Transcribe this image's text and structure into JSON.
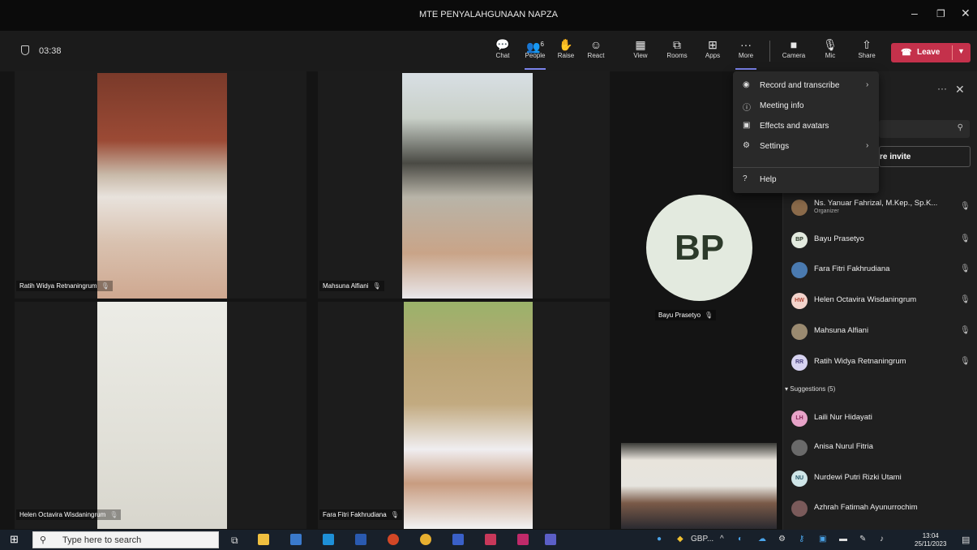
{
  "window": {
    "title": "MTE PENYALAHGUNAAN NAPZA",
    "minimize": "–",
    "maximize": "❐",
    "close": "✕"
  },
  "toolbar": {
    "timer": "03:38",
    "buttons": [
      {
        "label": "Chat",
        "icon": "💬"
      },
      {
        "label": "People",
        "icon": "👥",
        "badge": "6"
      },
      {
        "label": "Raise",
        "icon": "✋"
      },
      {
        "label": "React",
        "icon": "☺"
      },
      {
        "label": "View",
        "icon": "▦"
      },
      {
        "label": "Rooms",
        "icon": "⧉"
      },
      {
        "label": "Apps",
        "icon": "⊞"
      },
      {
        "label": "More",
        "icon": "···"
      },
      {
        "label": "Camera",
        "icon": "■"
      },
      {
        "label": "Mic",
        "icon": "🎙"
      },
      {
        "label": "Share",
        "icon": "⇧"
      }
    ],
    "leave_label": "Leave"
  },
  "tiles": [
    {
      "name": "Ratih Widya Retnaningrum"
    },
    {
      "name": "Mahsuna Alfiani"
    },
    {
      "name": "Helen Octavira Wisdaningrum"
    },
    {
      "name": "Fara Fitri Fakhrudiana"
    },
    {
      "name": "Bayu Prasetyo",
      "initials": "BP"
    }
  ],
  "more_menu": {
    "items": [
      {
        "label": "Record and transcribe",
        "icon": "◉",
        "submenu": true
      },
      {
        "label": "Meeting info",
        "icon": "ⓘ"
      },
      {
        "label": "Effects and avatars",
        "icon": "▣"
      },
      {
        "label": "Settings",
        "icon": "⚙",
        "submenu": true
      },
      {
        "label": "Help",
        "icon": "?"
      }
    ]
  },
  "panel": {
    "share_invite": "re invite",
    "participants": [
      {
        "name": "Ns. Yanuar Fahrizal, M.Kep., Sp.K...",
        "role": "Organizer",
        "avatar_color": "#8a6a4a",
        "mic": "unmuted"
      },
      {
        "name": "Bayu Prasetyo",
        "initials": "BP",
        "avatar_color": "#e3eadf"
      },
      {
        "name": "Fara Fitri Fakhrudiana",
        "avatar_color": "#4a7ab0"
      },
      {
        "name": "Helen Octavira Wisdaningrum",
        "initials": "HW",
        "avatar_color": "#f3d4cc"
      },
      {
        "name": "Mahsuna Alfiani",
        "avatar_color": "#9a8a70"
      },
      {
        "name": "Ratih Widya Retnaningrum",
        "initials": "RR",
        "avatar_color": "#d7d3f0"
      }
    ],
    "suggestions_label": "Suggestions (5)",
    "suggestions": [
      {
        "name": "Laili Nur Hidayati",
        "initials": "LH",
        "avatar_color": "#e7a3c8"
      },
      {
        "name": "Anisa Nurul Fitria",
        "avatar_color": "#6a6a6a"
      },
      {
        "name": "Nurdewi Putri Rizki Utami",
        "initials": "NU",
        "avatar_color": "#cfe6e8"
      },
      {
        "name": "Azhrah Fatimah Ayunurrochim",
        "avatar_color": "#7a5a5a"
      }
    ]
  },
  "taskbar": {
    "search_placeholder": "Type here to search",
    "tray_item": "GBP...",
    "time": "13:04",
    "date": "25/11/2023"
  }
}
